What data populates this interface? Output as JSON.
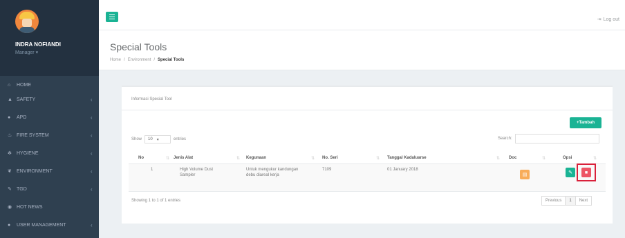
{
  "sidebar": {
    "user_name": "INDRA NOFIANDI",
    "user_role": "Manager ▾",
    "items": [
      {
        "label": "Home",
        "icon": "home-icon"
      },
      {
        "label": "SAFETY",
        "icon": "thumbs-up-icon"
      },
      {
        "label": "APD",
        "icon": "user-icon"
      },
      {
        "label": "FIRE SYSTEM",
        "icon": "fire-icon"
      },
      {
        "label": "HYGIENE",
        "icon": "bug-icon"
      },
      {
        "label": "ENVIRONMENT",
        "icon": "leaf-icon"
      },
      {
        "label": "TGD",
        "icon": "tools-icon"
      },
      {
        "label": "HOT NEWS",
        "icon": "globe-icon"
      },
      {
        "label": "USER MANAGEMENT",
        "icon": "users-icon"
      }
    ]
  },
  "topbar": {
    "logout_label": "Log out"
  },
  "heading": {
    "title": "Special Tools",
    "breadcrumb": [
      "Home",
      "Environment",
      "Special Tools"
    ]
  },
  "box": {
    "title": "Informasi Special Tool",
    "add_button": "+Tambah",
    "show_label": "Show",
    "show_value": "10",
    "entries_label": "entries",
    "search_label": "Search:",
    "columns": [
      "No",
      "Jenis Alat",
      "Kegunaan",
      "No. Seri",
      "Tanggal Kadaluarse",
      "Doc",
      "Opsi"
    ],
    "rows": [
      {
        "no": "1",
        "jenis_alat": "High Volume Dust Sampler",
        "kegunaan": "Untuk mengukur kandungan debu diareal kerja",
        "no_seri": "7109",
        "tanggal": "01 January 2018"
      }
    ],
    "info": "Showing 1 to 1 of 1 entries",
    "pager": {
      "prev": "Previous",
      "page": "1",
      "next": "Next"
    }
  },
  "colors": {
    "primary": "#1ab394",
    "warning": "#f8ac59",
    "danger": "#ed5565",
    "highlight": "#d9203a",
    "sidebar": "#2f4050"
  }
}
